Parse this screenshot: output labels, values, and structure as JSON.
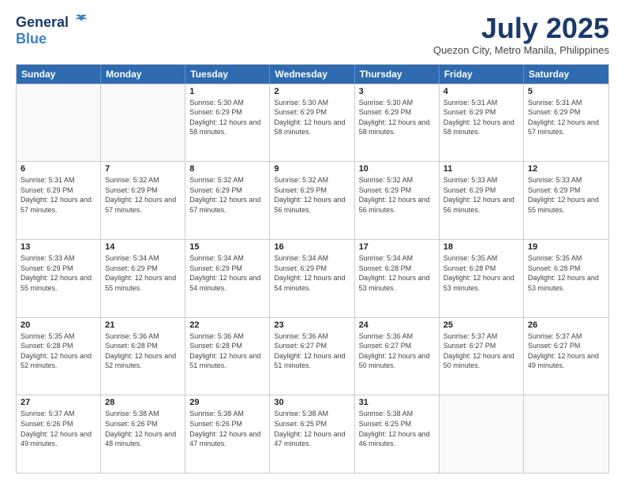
{
  "header": {
    "logo_line1": "General",
    "logo_line2": "Blue",
    "month": "July 2025",
    "location": "Quezon City, Metro Manila, Philippines"
  },
  "days_of_week": [
    "Sunday",
    "Monday",
    "Tuesday",
    "Wednesday",
    "Thursday",
    "Friday",
    "Saturday"
  ],
  "weeks": [
    [
      {
        "day": "",
        "empty": true
      },
      {
        "day": "",
        "empty": true
      },
      {
        "day": "1",
        "sunrise": "Sunrise: 5:30 AM",
        "sunset": "Sunset: 6:29 PM",
        "daylight": "Daylight: 12 hours and 58 minutes."
      },
      {
        "day": "2",
        "sunrise": "Sunrise: 5:30 AM",
        "sunset": "Sunset: 6:29 PM",
        "daylight": "Daylight: 12 hours and 58 minutes."
      },
      {
        "day": "3",
        "sunrise": "Sunrise: 5:30 AM",
        "sunset": "Sunset: 6:29 PM",
        "daylight": "Daylight: 12 hours and 58 minutes."
      },
      {
        "day": "4",
        "sunrise": "Sunrise: 5:31 AM",
        "sunset": "Sunset: 6:29 PM",
        "daylight": "Daylight: 12 hours and 58 minutes."
      },
      {
        "day": "5",
        "sunrise": "Sunrise: 5:31 AM",
        "sunset": "Sunset: 6:29 PM",
        "daylight": "Daylight: 12 hours and 57 minutes."
      }
    ],
    [
      {
        "day": "6",
        "sunrise": "Sunrise: 5:31 AM",
        "sunset": "Sunset: 6:29 PM",
        "daylight": "Daylight: 12 hours and 57 minutes."
      },
      {
        "day": "7",
        "sunrise": "Sunrise: 5:32 AM",
        "sunset": "Sunset: 6:29 PM",
        "daylight": "Daylight: 12 hours and 57 minutes."
      },
      {
        "day": "8",
        "sunrise": "Sunrise: 5:32 AM",
        "sunset": "Sunset: 6:29 PM",
        "daylight": "Daylight: 12 hours and 57 minutes."
      },
      {
        "day": "9",
        "sunrise": "Sunrise: 5:32 AM",
        "sunset": "Sunset: 6:29 PM",
        "daylight": "Daylight: 12 hours and 56 minutes."
      },
      {
        "day": "10",
        "sunrise": "Sunrise: 5:32 AM",
        "sunset": "Sunset: 6:29 PM",
        "daylight": "Daylight: 12 hours and 56 minutes."
      },
      {
        "day": "11",
        "sunrise": "Sunrise: 5:33 AM",
        "sunset": "Sunset: 6:29 PM",
        "daylight": "Daylight: 12 hours and 56 minutes."
      },
      {
        "day": "12",
        "sunrise": "Sunrise: 5:33 AM",
        "sunset": "Sunset: 6:29 PM",
        "daylight": "Daylight: 12 hours and 55 minutes."
      }
    ],
    [
      {
        "day": "13",
        "sunrise": "Sunrise: 5:33 AM",
        "sunset": "Sunset: 6:29 PM",
        "daylight": "Daylight: 12 hours and 55 minutes."
      },
      {
        "day": "14",
        "sunrise": "Sunrise: 5:34 AM",
        "sunset": "Sunset: 6:29 PM",
        "daylight": "Daylight: 12 hours and 55 minutes."
      },
      {
        "day": "15",
        "sunrise": "Sunrise: 5:34 AM",
        "sunset": "Sunset: 6:29 PM",
        "daylight": "Daylight: 12 hours and 54 minutes."
      },
      {
        "day": "16",
        "sunrise": "Sunrise: 5:34 AM",
        "sunset": "Sunset: 6:29 PM",
        "daylight": "Daylight: 12 hours and 54 minutes."
      },
      {
        "day": "17",
        "sunrise": "Sunrise: 5:34 AM",
        "sunset": "Sunset: 6:28 PM",
        "daylight": "Daylight: 12 hours and 53 minutes."
      },
      {
        "day": "18",
        "sunrise": "Sunrise: 5:35 AM",
        "sunset": "Sunset: 6:28 PM",
        "daylight": "Daylight: 12 hours and 53 minutes."
      },
      {
        "day": "19",
        "sunrise": "Sunrise: 5:35 AM",
        "sunset": "Sunset: 6:28 PM",
        "daylight": "Daylight: 12 hours and 53 minutes."
      }
    ],
    [
      {
        "day": "20",
        "sunrise": "Sunrise: 5:35 AM",
        "sunset": "Sunset: 6:28 PM",
        "daylight": "Daylight: 12 hours and 52 minutes."
      },
      {
        "day": "21",
        "sunrise": "Sunrise: 5:36 AM",
        "sunset": "Sunset: 6:28 PM",
        "daylight": "Daylight: 12 hours and 52 minutes."
      },
      {
        "day": "22",
        "sunrise": "Sunrise: 5:36 AM",
        "sunset": "Sunset: 6:28 PM",
        "daylight": "Daylight: 12 hours and 51 minutes."
      },
      {
        "day": "23",
        "sunrise": "Sunrise: 5:36 AM",
        "sunset": "Sunset: 6:27 PM",
        "daylight": "Daylight: 12 hours and 51 minutes."
      },
      {
        "day": "24",
        "sunrise": "Sunrise: 5:36 AM",
        "sunset": "Sunset: 6:27 PM",
        "daylight": "Daylight: 12 hours and 50 minutes."
      },
      {
        "day": "25",
        "sunrise": "Sunrise: 5:37 AM",
        "sunset": "Sunset: 6:27 PM",
        "daylight": "Daylight: 12 hours and 50 minutes."
      },
      {
        "day": "26",
        "sunrise": "Sunrise: 5:37 AM",
        "sunset": "Sunset: 6:27 PM",
        "daylight": "Daylight: 12 hours and 49 minutes."
      }
    ],
    [
      {
        "day": "27",
        "sunrise": "Sunrise: 5:37 AM",
        "sunset": "Sunset: 6:26 PM",
        "daylight": "Daylight: 12 hours and 49 minutes."
      },
      {
        "day": "28",
        "sunrise": "Sunrise: 5:38 AM",
        "sunset": "Sunset: 6:26 PM",
        "daylight": "Daylight: 12 hours and 48 minutes."
      },
      {
        "day": "29",
        "sunrise": "Sunrise: 5:38 AM",
        "sunset": "Sunset: 6:26 PM",
        "daylight": "Daylight: 12 hours and 47 minutes."
      },
      {
        "day": "30",
        "sunrise": "Sunrise: 5:38 AM",
        "sunset": "Sunset: 6:25 PM",
        "daylight": "Daylight: 12 hours and 47 minutes."
      },
      {
        "day": "31",
        "sunrise": "Sunrise: 5:38 AM",
        "sunset": "Sunset: 6:25 PM",
        "daylight": "Daylight: 12 hours and 46 minutes."
      },
      {
        "day": "",
        "empty": true
      },
      {
        "day": "",
        "empty": true
      }
    ]
  ]
}
